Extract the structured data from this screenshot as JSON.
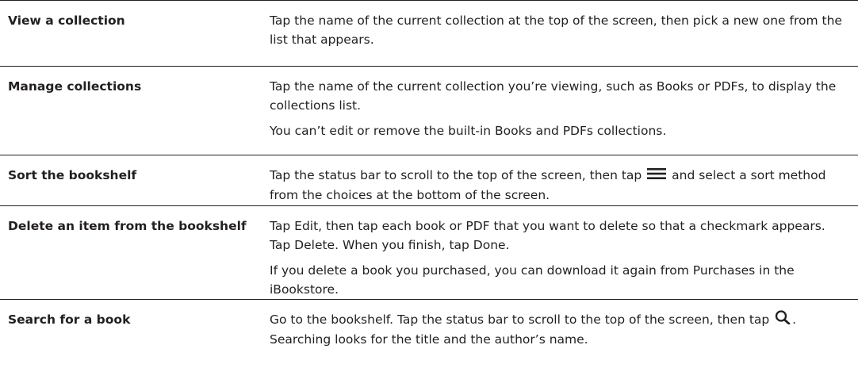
{
  "rows": [
    {
      "task": "View a collection",
      "desc": [
        "Tap the name of the current collection at the top of the screen, then pick a new one from the list that appears."
      ]
    },
    {
      "task": "Manage collections",
      "desc": [
        "Tap the name of the current collection you’re viewing, such as Books or PDFs, to display the collections list.",
        "You can’t edit or remove the built-in Books and PDFs collections."
      ]
    },
    {
      "task": "Sort the bookshelf",
      "desc_before_icon": "Tap the status bar to scroll to the top of the screen, then tap",
      "icon": "list-icon",
      "desc_after_icon": "and select a sort method from the choices at the bottom of the screen."
    },
    {
      "task": "Delete an item from the bookshelf",
      "desc": [
        "Tap Edit, then tap each book or PDF that you want to delete so that a checkmark appears. Tap Delete. When you finish, tap Done.",
        "If you delete a book you purchased, you can download it again from Purchases in the iBookstore."
      ]
    },
    {
      "task": "Search for a book",
      "desc_before_icon": "Go to the bookshelf. Tap the status bar to scroll to the top of the screen, then tap",
      "icon": "search-icon",
      "desc_after_icon": ". Searching looks for the title and the author’s name."
    }
  ]
}
